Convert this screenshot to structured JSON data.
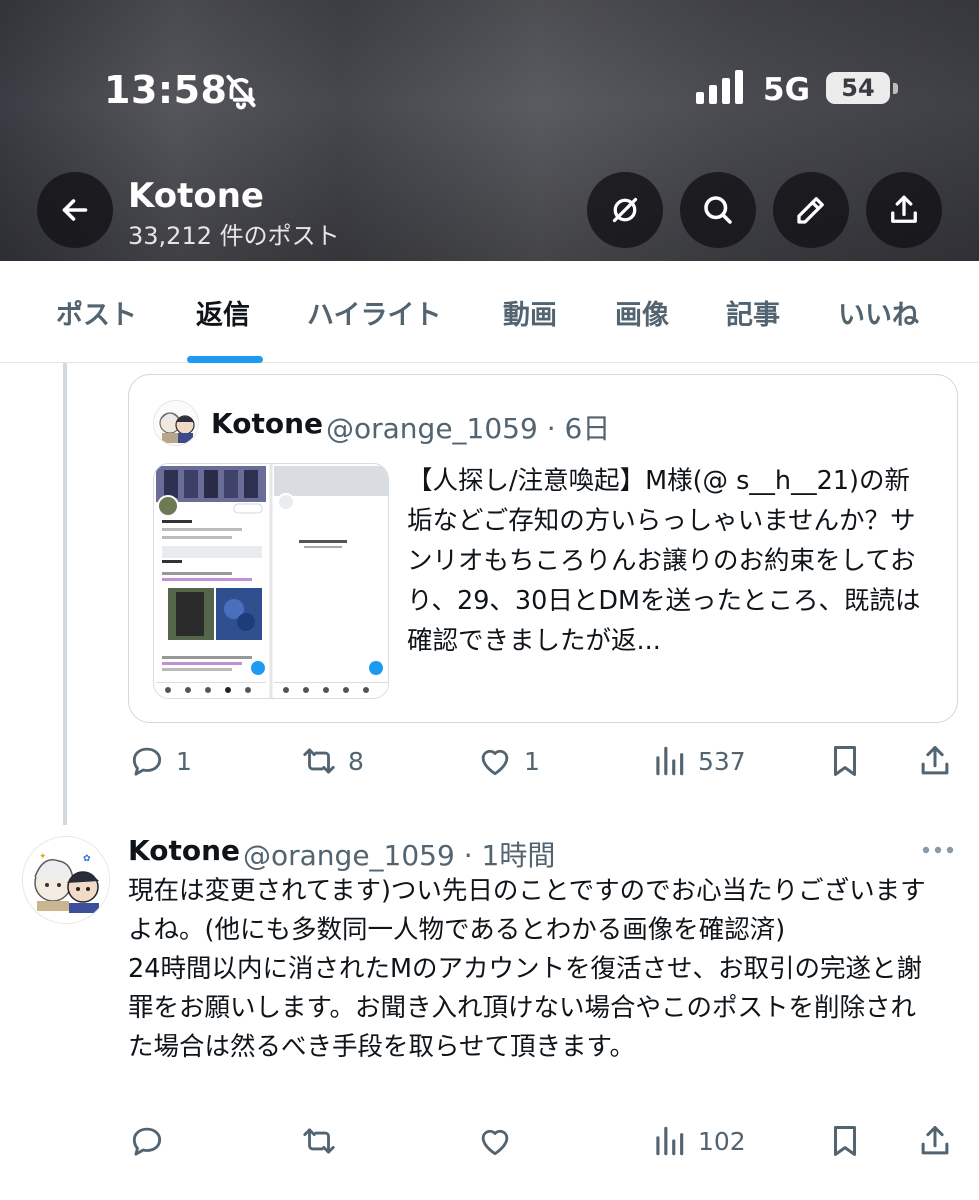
{
  "status": {
    "time": "13:58",
    "network": "5G",
    "battery": "54"
  },
  "profile": {
    "name": "Kotone",
    "post_count": "33,212 件のポスト"
  },
  "tabs": [
    {
      "label": "ポスト"
    },
    {
      "label": "返信"
    },
    {
      "label": "ハイライト"
    },
    {
      "label": "動画"
    },
    {
      "label": "画像"
    },
    {
      "label": "記事"
    },
    {
      "label": "いいね"
    }
  ],
  "quoted_post": {
    "name": "Kotone",
    "handle_time": "@orange_1059 · 6日",
    "text": "【人探し/注意喚起】M様(@ s__h__21)の新垢などご存知の方いらっしゃいませんか？サンリオもちころりんお譲りのお約束をしており、29、30日とDMを送ったところ、既読は確認できましたが返..."
  },
  "quoted_actions": {
    "replies": "1",
    "reposts": "8",
    "likes": "1",
    "views": "537"
  },
  "reply_post": {
    "name": "Kotone",
    "handle_time": "@orange_1059 · 1時間",
    "text": "現在は変更されてます)つい先日のことですのでお心当たりございますよね。(他にも多数同一人物であるとわかる画像を確認済)\n24時間以内に消されたMのアカウントを復活させ、お取引の完遂と謝罪をお願いします。お聞き入れ頂けない場合やこのポストを削除された場合は然るべき手段を取らせて頂きます。"
  },
  "reply_actions": {
    "views": "102"
  },
  "colors": {
    "accent": "#1d9bf0",
    "text_primary": "#0f1419",
    "text_secondary": "#536471",
    "border": "#cfd9de"
  }
}
